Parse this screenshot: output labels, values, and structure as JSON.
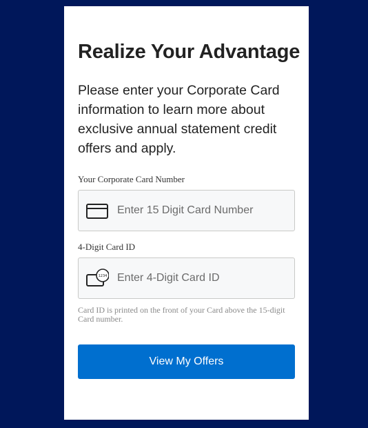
{
  "form": {
    "title": "Realize Your Advantage",
    "intro": "Please enter your Corporate Card information to learn more about exclusive annual statement credit offers and apply.",
    "card_number": {
      "label": "Your Corporate Card Number",
      "placeholder": "Enter 15 Digit Card Number",
      "value": "",
      "icon": "credit-card-icon"
    },
    "card_id": {
      "label": "4-Digit Card ID",
      "placeholder": "Enter 4-Digit Card ID",
      "value": "",
      "icon": "card-id-icon",
      "icon_text": "1234"
    },
    "hint": "Card ID is printed on the front of your Card above the 15-digit Card number.",
    "submit_label": "View My Offers"
  },
  "colors": {
    "background": "#00175a",
    "panel": "#ffffff",
    "button": "#006fcf",
    "input_bg": "#f7f8f9",
    "input_border": "#c8c9c7"
  }
}
